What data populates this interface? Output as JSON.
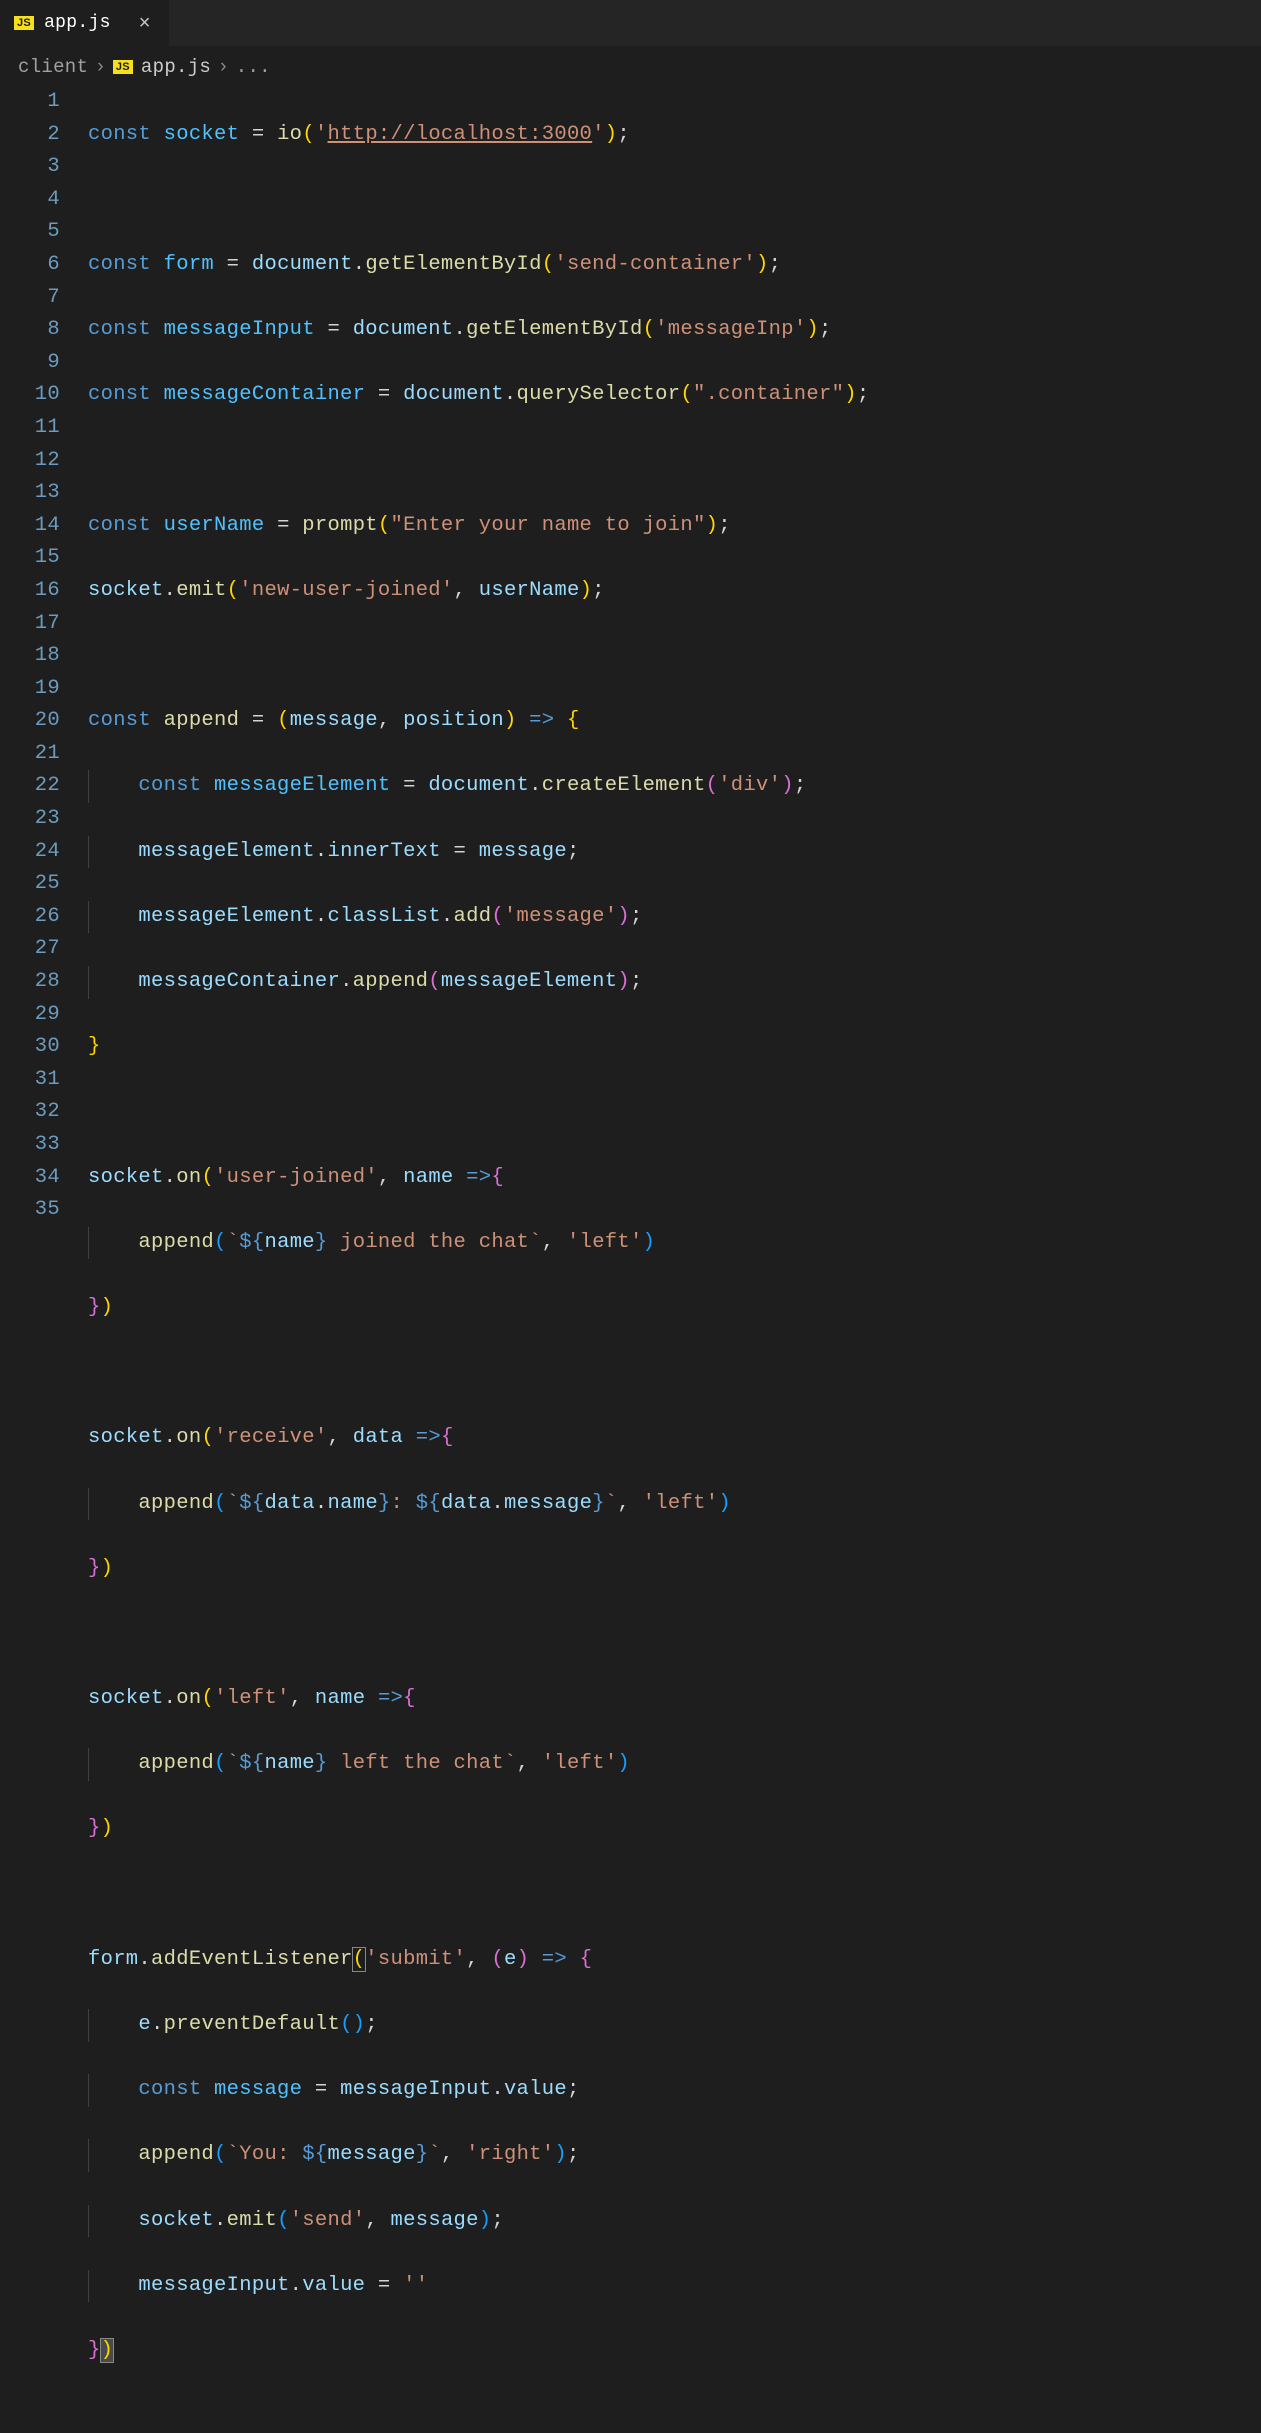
{
  "tab": {
    "icon_label": "JS",
    "filename": "app.js"
  },
  "breadcrumbs": {
    "folder": "client",
    "file_icon": "JS",
    "file": "app.js",
    "tail": "..."
  },
  "line_numbers": [
    "1",
    "2",
    "3",
    "4",
    "5",
    "6",
    "7",
    "8",
    "9",
    "10",
    "11",
    "12",
    "13",
    "14",
    "15",
    "16",
    "17",
    "18",
    "19",
    "20",
    "21",
    "22",
    "23",
    "24",
    "25",
    "26",
    "27",
    "28",
    "29",
    "30",
    "31",
    "32",
    "33",
    "34",
    "35"
  ],
  "code": {
    "l1": {
      "url": "http://localhost:3000"
    },
    "l3": {
      "id": "send-container"
    },
    "l4": {
      "id": "messageInp"
    },
    "l5": {
      "sel": ".container"
    },
    "l7": {
      "prompt": "Enter your name to join"
    },
    "l8": {
      "event": "new-user-joined"
    },
    "l10": {
      "p1": "message",
      "p2": "position"
    },
    "l11": {
      "tag": "div"
    },
    "l13": {
      "cls": "message"
    },
    "l17": {
      "event": "user-joined",
      "param": "name"
    },
    "l18": {
      "pos": "left",
      "txt": " joined the chat"
    },
    "l21": {
      "event": "receive",
      "param": "data"
    },
    "l22": {
      "pos": "left"
    },
    "l25": {
      "event": "left",
      "param": "name"
    },
    "l26": {
      "pos": "left",
      "txt": " left the chat"
    },
    "l29": {
      "event": "submit",
      "param": "e"
    },
    "l32": {
      "prefix": "You: ",
      "pos": "right"
    },
    "l33": {
      "event": "send"
    }
  }
}
